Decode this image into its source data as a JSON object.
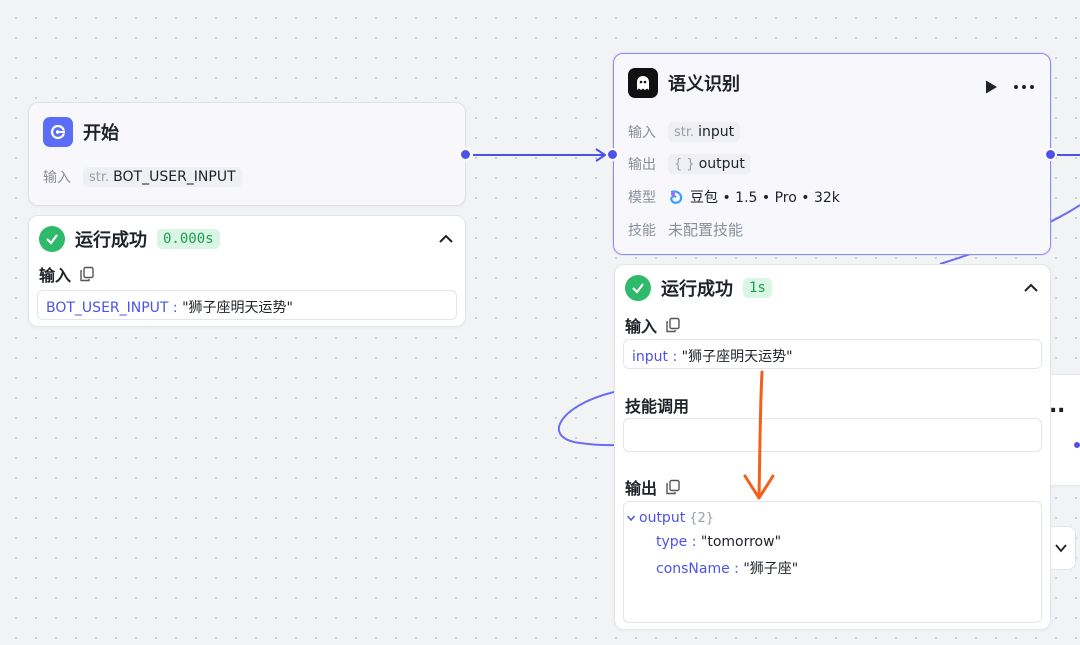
{
  "start_node": {
    "title": "开始",
    "input_label": "输入",
    "input_type": "str.",
    "input_value": "BOT_USER_INPUT"
  },
  "start_result": {
    "status": "运行成功",
    "time": "0.000s",
    "input_title": "输入",
    "input_key": "BOT_USER_INPUT",
    "input_value": "\"狮子座明天运势\""
  },
  "intent_node": {
    "title": "语义识别",
    "input_label": "输入",
    "input_type": "str.",
    "input_value": "input",
    "output_label": "输出",
    "output_type": "{ }",
    "output_value": "output",
    "model_label": "模型",
    "model_value": "豆包 • 1.5 • Pro • 32k",
    "skill_label": "技能",
    "skill_value": "未配置技能",
    "run_icon": "play-icon",
    "more_icon": "more-icon"
  },
  "intent_result": {
    "status": "运行成功",
    "time": "1s",
    "input_title": "输入",
    "input_key": "input",
    "input_value": "\"狮子座明天运势\"",
    "skill_title": "技能调用",
    "output_title": "输出",
    "output_root": "output",
    "output_count": "{2}",
    "output_fields": [
      {
        "key": "type",
        "value": "\"tomorrow\""
      },
      {
        "key": "consName",
        "value": "\"狮子座\""
      }
    ]
  },
  "peek_node": {
    "ellipsis": "."
  },
  "colors": {
    "accent": "#4d53e8",
    "success": "#2fb96b",
    "annotation_arrow": "#f2601c"
  }
}
